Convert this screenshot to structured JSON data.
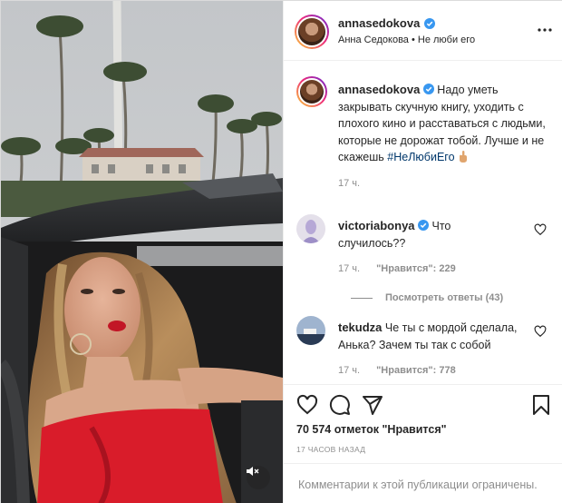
{
  "post": {
    "author": {
      "username": "annasedokova",
      "verified": true,
      "subtitle": "Анна Седокова • Не люби его"
    },
    "caption": {
      "username": "annasedokova",
      "text": "Надо уметь закрывать скучную книгу, уходить с плохого кино и расставаться с людьми, которые не дорожат тобой. Лучше и не скажешь",
      "hashtag": "#НеЛюбиЕго",
      "time": "17 ч."
    },
    "comments": [
      {
        "username": "victoriabonya",
        "verified": true,
        "text": "Что случилось??",
        "time": "17 ч.",
        "likes_label": "\"Нравится\": 229",
        "view_replies": "Посмотреть ответы (43)"
      },
      {
        "username": "tekudza",
        "verified": false,
        "text": "Че ты с мордой сделала, Анька? Зачем ты так с собой",
        "time": "17 ч.",
        "likes_label": "\"Нравится\": 778"
      }
    ],
    "likes_text": "70 574 отметок \"Нравится\"",
    "timestamp": "17 ЧАСОВ НАЗАД",
    "comments_restricted": "Комментарии к этой публикации ограничены."
  },
  "icons": {
    "like": "heart-icon",
    "comment": "comment-icon",
    "share": "paper-plane-icon",
    "save": "bookmark-icon",
    "mute": "speaker-muted-icon",
    "more": "more-options-icon"
  },
  "colors": {
    "verified": "#3897f0",
    "hashtag": "#00376b",
    "secondary_text": "#8e8e8e",
    "border": "#efefef"
  }
}
